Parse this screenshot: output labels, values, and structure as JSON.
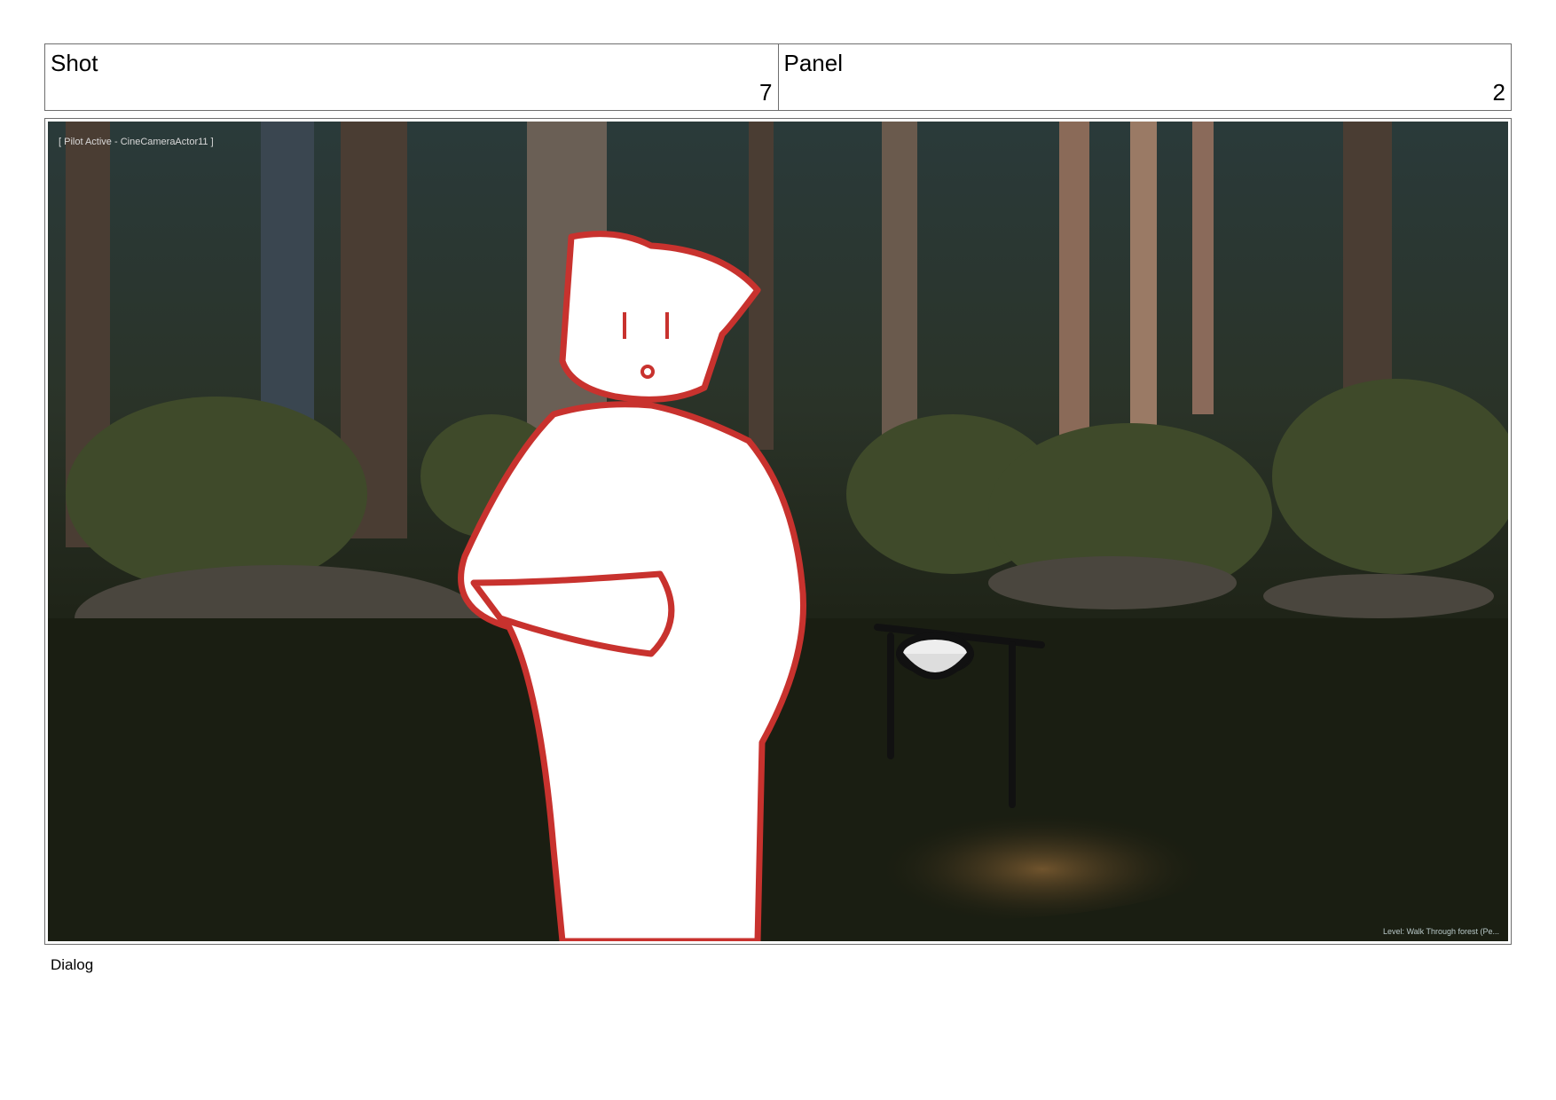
{
  "header": {
    "shot": {
      "label": "Shot",
      "value": "7"
    },
    "panel": {
      "label": "Panel",
      "value": "2"
    }
  },
  "frame": {
    "overlay_top": "[ Pilot Active - CineCameraActor11 ]",
    "overlay_bottom": "Level: Walk Through forest (Pe..."
  },
  "dialog": {
    "label": "Dialog"
  }
}
